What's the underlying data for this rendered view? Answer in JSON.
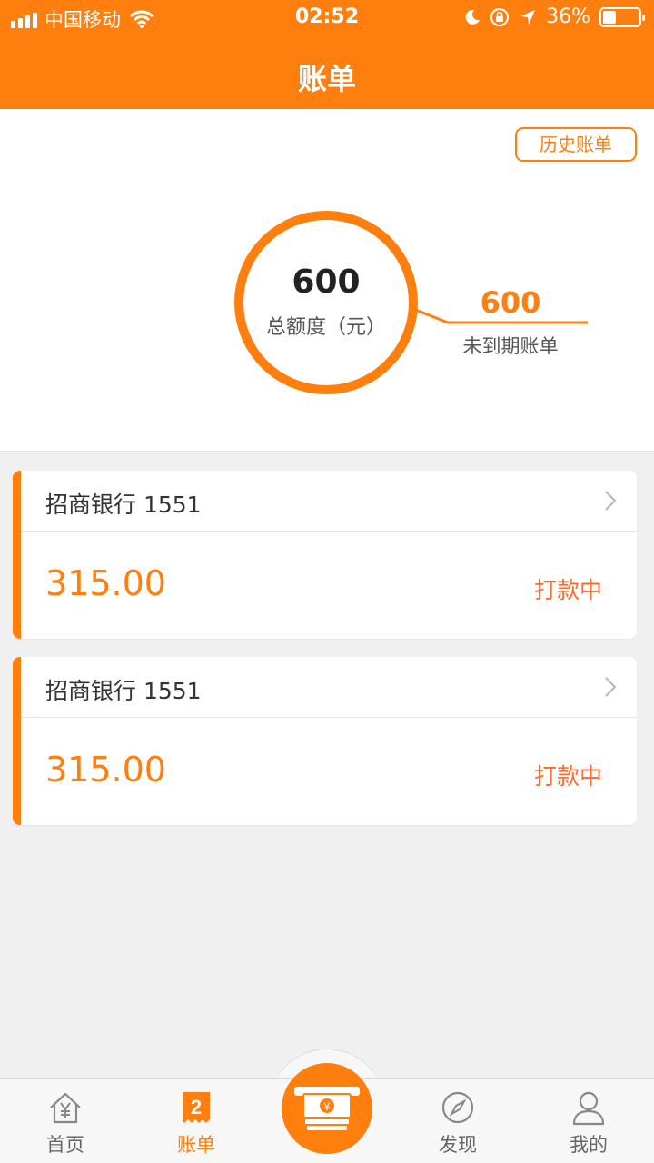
{
  "status_bar": {
    "carrier": "中国移动",
    "time": "02:52",
    "battery": "36%",
    "battery_level": 0.36
  },
  "nav": {
    "title": "账单"
  },
  "summary": {
    "history_button": "历史账单",
    "total_amount": "600",
    "total_label": "总额度（元）",
    "pending_amount": "600",
    "pending_label": "未到期账单"
  },
  "bills": [
    {
      "bank": "招商银行 1551",
      "amount": "315.00",
      "status": "打款中"
    },
    {
      "bank": "招商银行 1551",
      "amount": "315.00",
      "status": "打款中"
    }
  ],
  "tabbar": {
    "items": [
      {
        "label": "首页",
        "icon": "home-yen-icon"
      },
      {
        "label": "账单",
        "icon": "bill-icon",
        "badge": "2"
      },
      {
        "label": "",
        "icon": "cash-center-icon"
      },
      {
        "label": "发现",
        "icon": "compass-icon"
      },
      {
        "label": "我的",
        "icon": "user-icon"
      }
    ]
  },
  "colors": {
    "accent": "#ff7f0e",
    "status_text": "#ff6a2a"
  }
}
